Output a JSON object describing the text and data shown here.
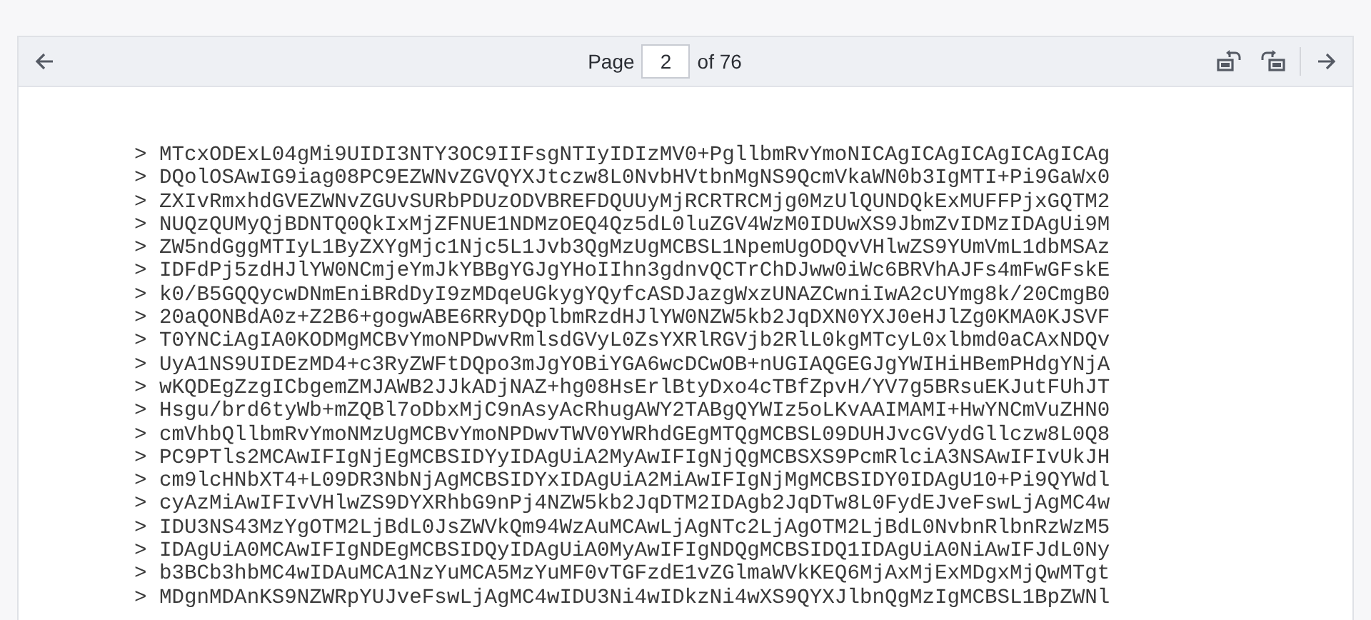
{
  "toolbar": {
    "page_label": "Page",
    "page_value": "2",
    "page_total": "of 76"
  },
  "lines": [
    "> MTcxODExL04gMi9UIDI3NTY3OC9IIFsgNTIyIDIzMV0+PgllbmRvYmoNICAgICAgICAgICAgICAg",
    "> DQolOSAwIG9iag08PC9EZWNvZGVQYXJtczw8L0NvbHVtbnMgNS9QcmVkaWN0b3IgMTI+Pi9GaWx0",
    "> ZXIvRmxhdGVEZWNvZGUvSURbPDUzODVBREFDQUUyMjRCRTRCMjg0MzUlQUNDQkExMUFFPjxGQTM2",
    "> NUQzQUMyQjBDNTQ0QkIxMjZFNUE1NDMzOEQ4Qz5dL0luZGV4WzM0IDUwXS9JbmZvIDMzIDAgUi9M",
    "> ZW5ndGggMTIyL1ByZXYgMjc1Njc5L1Jvb3QgMzUgMCBSL1NpemUgODQvVHlwZS9YUmVmL1dbMSAz",
    "> IDFdPj5zdHJlYW0NCmjeYmJkYBBgYGJgYHoIIhn3gdnvQCTrChDJww0iWc6BRVhAJFs4mFwGFskE",
    "> k0/B5GQQycwDNmEniBRdDyI9zMDqeUGkygYQyfcASDJazgWxzUNAZCwniIwA2cUYmg8k/20CmgB0",
    "> 20aQONBdA0z+Z2B6+gogwABE6RRyDQplbmRzdHJlYW0NZW5kb2JqDXN0YXJ0eHJlZg0KMA0KJSVF",
    "> T0YNCiAgIA0KODMgMCBvYmoNPDwvRmlsdGVyL0ZsYXRlRGVjb2RlL0kgMTcyL0xlbmd0aCAxNDQv",
    "> UyA1NS9UIDEzMD4+c3RyZWFtDQpo3mJgYOBiYGA6wcDCwOB+nUGIAQGEGJgYWIHiHBemPHdgYNjA",
    "> wKQDEgZzgICbgemZMJAWB2JJkADjNAZ+hg08HsErlBtyDxo4cTBfZpvH/YV7g5BRsuEKJutFUhJT",
    "> Hsgu/brd6tyWb+mZQBl7oDbxMjC9nAsyAcRhugAWY2TABgQYWIz5oLKvAAIMAMI+HwYNCmVuZHN0",
    "> cmVhbQllbmRvYmoNMzUgMCBvYmoNPDwvTWV0YWRhdGEgMTQgMCBSL09DUHJvcGVydGllczw8L0Q8",
    "> PC9PTls2MCAwIFIgNjEgMCBSIDYyIDAgUiA2MyAwIFIgNjQgMCBSXS9PcmRlciA3NSAwIFIvUkJH",
    "> cm9lcHNbXT4+L09DR3NbNjAgMCBSIDYxIDAgUiA2MiAwIFIgNjMgMCBSIDY0IDAgU10+Pi9QYWdl",
    "> cyAzMiAwIFIvVHlwZS9DYXRhbG9nPj4NZW5kb2JqDTM2IDAgb2JqDTw8L0FydEJveFswLjAgMC4w",
    "> IDU3NS43MzYgOTM2LjBdL0JsZWVkQm94WzAuMCAwLjAgNTc2LjAgOTM2LjBdL0NvbnRlbnRzWzM5",
    "> IDAgUiA0MCAwIFIgNDEgMCBSIDQyIDAgUiA0MyAwIFIgNDQgMCBSIDQ1IDAgUiA0NiAwIFJdL0Ny",
    "> b3BCb3hbMC4wIDAuMCA1NzYuMCA5MzYuMF0vTGFzdE1vZGlmaWVkKEQ6MjAxMjExMDgxMjQwMTgt",
    "> MDgnMDAnKS9NZWRpYUJveFswLjAgMC4wIDU3Ni4wIDkzNi4wXS9QYXJlbnQgMzIgMCBSL1BpZWNl"
  ]
}
